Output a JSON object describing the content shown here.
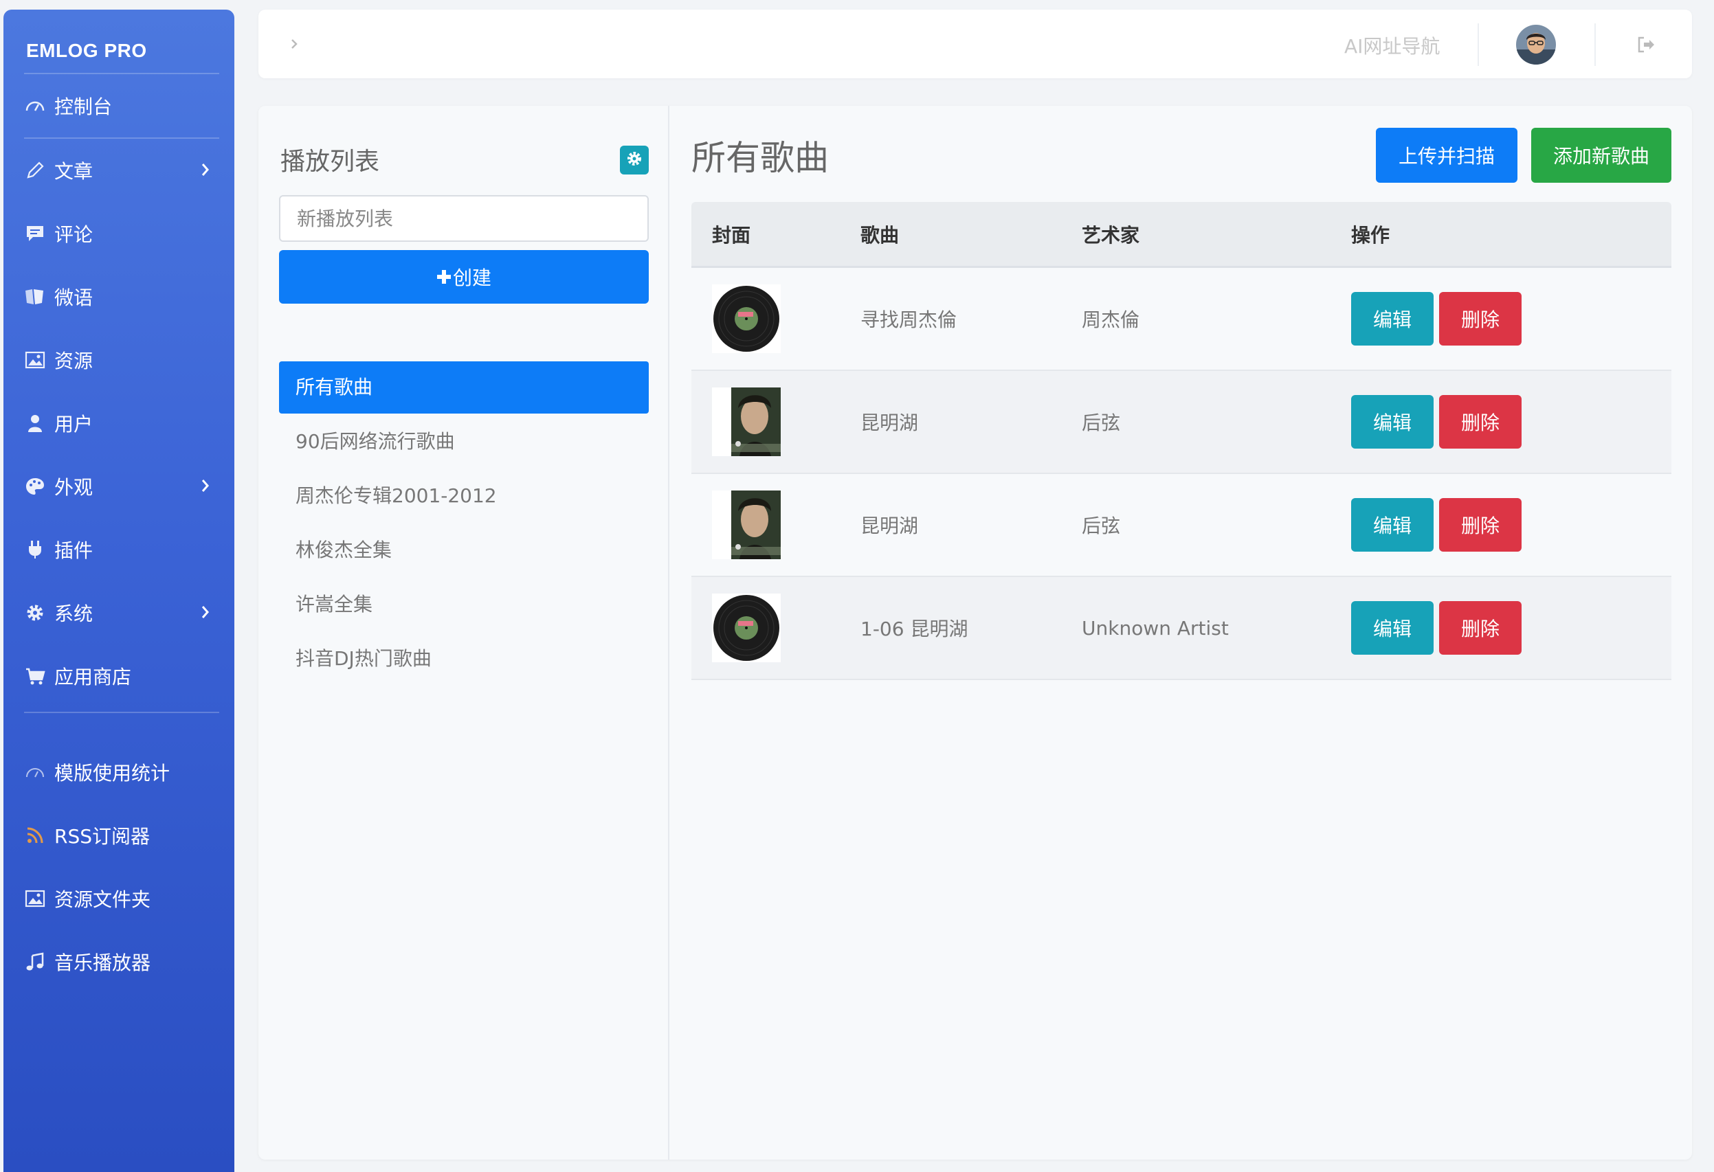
{
  "brand": "EMLOG PRO",
  "sidebar": {
    "items": [
      {
        "label": "控制台",
        "icon": "dashboard-icon"
      },
      {
        "label": "文章",
        "icon": "pencil-icon",
        "has_submenu": true
      },
      {
        "label": "评论",
        "icon": "comment-icon"
      },
      {
        "label": "微语",
        "icon": "notes-icon"
      },
      {
        "label": "资源",
        "icon": "image-icon"
      },
      {
        "label": "用户",
        "icon": "user-icon"
      },
      {
        "label": "外观",
        "icon": "palette-icon",
        "has_submenu": true
      },
      {
        "label": "插件",
        "icon": "plug-icon"
      },
      {
        "label": "系统",
        "icon": "gear-icon",
        "has_submenu": true
      },
      {
        "label": "应用商店",
        "icon": "cart-icon"
      }
    ],
    "extras": [
      {
        "label": "模版使用统计",
        "icon": "dashboard-icon"
      },
      {
        "label": "RSS订阅器",
        "icon": "rss-icon"
      },
      {
        "label": "资源文件夹",
        "icon": "image-icon"
      },
      {
        "label": "音乐播放器",
        "icon": "music-icon"
      }
    ]
  },
  "topbar": {
    "nav_link": "AI网址导航"
  },
  "playlists": {
    "title": "播放列表",
    "input_placeholder": "新播放列表",
    "create_label": "创建",
    "items": [
      "所有歌曲",
      "90后网络流行歌曲",
      "周杰伦专辑2001-2012",
      "林俊杰全集",
      "许嵩全集",
      "抖音DJ热门歌曲"
    ],
    "active_index": 0
  },
  "songs": {
    "title": "所有歌曲",
    "upload_label": "上传并扫描",
    "add_label": "添加新歌曲",
    "columns": [
      "封面",
      "歌曲",
      "艺术家",
      "操作"
    ],
    "edit_label": "编辑",
    "delete_label": "删除",
    "rows": [
      {
        "cover": "vinyl",
        "song": "寻找周杰倫",
        "artist": "周杰倫"
      },
      {
        "cover": "portrait",
        "song": "昆明湖",
        "artist": "后弦"
      },
      {
        "cover": "portrait",
        "song": "昆明湖",
        "artist": "后弦"
      },
      {
        "cover": "vinyl",
        "song": "1-06 昆明湖",
        "artist": "Unknown Artist"
      }
    ]
  },
  "colors": {
    "primary": "#0d7cf7",
    "success": "#28a745",
    "info": "#17a2b8",
    "danger": "#dc3545",
    "sidebar_top": "#4c78df",
    "sidebar_bottom": "#2a4ec2"
  }
}
